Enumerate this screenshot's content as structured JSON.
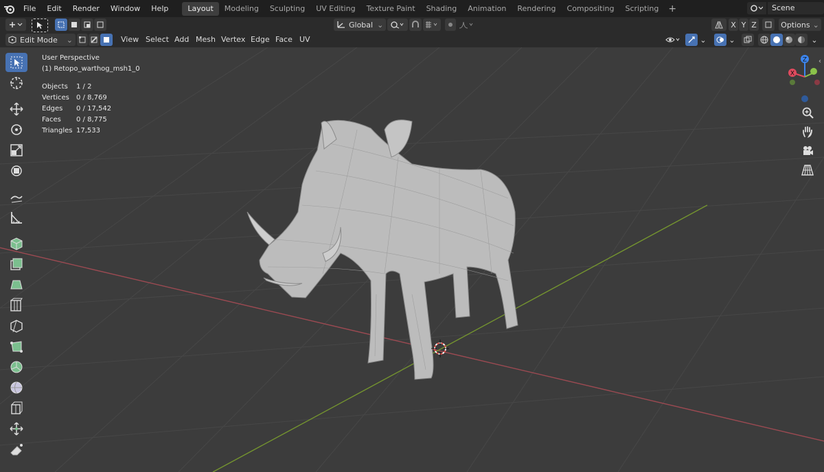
{
  "menu": {
    "items": [
      "File",
      "Edit",
      "Render",
      "Window",
      "Help"
    ]
  },
  "workspaces": {
    "tabs": [
      "Layout",
      "Modeling",
      "Sculpting",
      "UV Editing",
      "Texture Paint",
      "Shading",
      "Animation",
      "Rendering",
      "Compositing",
      "Scripting"
    ],
    "active": "Layout",
    "add_label": "+"
  },
  "scene": {
    "label": "Scene"
  },
  "header": {
    "orientation": "Global",
    "options_label": "Options",
    "axes": [
      "X",
      "Y",
      "Z"
    ]
  },
  "viewport_header": {
    "mode": "Edit Mode",
    "menus": [
      "View",
      "Select",
      "Add",
      "Mesh",
      "Vertex",
      "Edge",
      "Face",
      "UV"
    ]
  },
  "overlay": {
    "view_name": "User Perspective",
    "object_name": "(1) Retopo_warthog_msh1_0",
    "stats": [
      {
        "label": "Objects",
        "value": "1 / 2"
      },
      {
        "label": "Vertices",
        "value": "0 / 8,769"
      },
      {
        "label": "Edges",
        "value": "0 / 17,542"
      },
      {
        "label": "Faces",
        "value": "0 / 8,775"
      },
      {
        "label": "Triangles",
        "value": "17,533"
      }
    ]
  },
  "gizmo": {
    "x_label": "X",
    "y_label": "Y",
    "z_label": "Z"
  },
  "colors": {
    "accent": "#4772b3",
    "x_axis": "#e04a5e",
    "y_axis": "#8bc34a",
    "z_axis": "#3d86f0",
    "mesh": "#cfcfcf"
  }
}
